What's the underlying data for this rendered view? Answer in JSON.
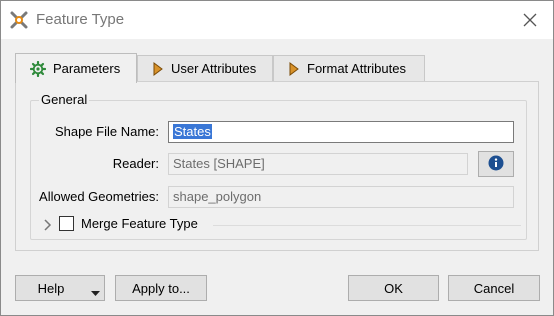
{
  "window": {
    "title": "Feature Type",
    "app_icon": "fme-workbench-icon",
    "close_icon": "close-icon"
  },
  "tabs": [
    {
      "label": "Parameters",
      "icon": "gear-icon",
      "active": true
    },
    {
      "label": "User Attributes",
      "icon": "arrow-right-icon",
      "active": false
    },
    {
      "label": "Format Attributes",
      "icon": "arrow-right-icon",
      "active": false
    }
  ],
  "general": {
    "title": "General",
    "shape_file_name": {
      "label": "Shape File Name:",
      "value": "States"
    },
    "reader": {
      "label": "Reader:",
      "value": "States [SHAPE]",
      "info_icon": "info-icon"
    },
    "allowed_geometries": {
      "label": "Allowed Geometries:",
      "value": "shape_polygon"
    },
    "merge": {
      "label": "Merge Feature Type",
      "checked": false,
      "expand_icon": "chevron-right-icon"
    }
  },
  "footer": {
    "help": "Help",
    "apply_to": "Apply to...",
    "ok": "OK",
    "cancel": "Cancel"
  },
  "colors": {
    "selection": "#3a77d6",
    "gear": "#2f8a3b",
    "arrow": "#c57b10"
  }
}
